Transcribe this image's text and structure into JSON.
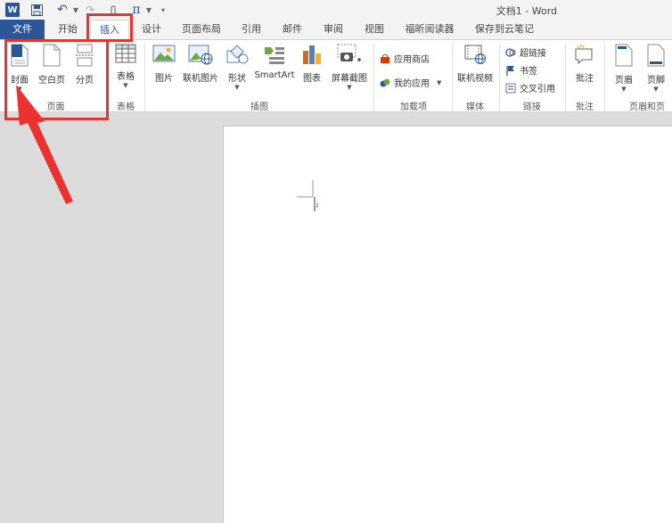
{
  "window": {
    "title": "文档1 - Word"
  },
  "quick_access": {
    "app_icon": "W",
    "items": [
      "word-icon",
      "save-icon",
      "undo-icon",
      "redo-icon",
      "touch-mode-icon",
      "equation-icon",
      "customize-arrow-icon"
    ],
    "pi_symbol": "π"
  },
  "tabs": [
    {
      "label": "文件"
    },
    {
      "label": "开始"
    },
    {
      "label": "插入"
    },
    {
      "label": "设计"
    },
    {
      "label": "页面布局"
    },
    {
      "label": "引用"
    },
    {
      "label": "邮件"
    },
    {
      "label": "审阅"
    },
    {
      "label": "视图"
    },
    {
      "label": "福昕阅读器"
    },
    {
      "label": "保存到云笔记"
    }
  ],
  "active_tab": "插入",
  "ribbon": {
    "pages": {
      "label": "页面",
      "cover": "封面",
      "blank_page": "空白页",
      "page_break": "分页"
    },
    "tables": {
      "label": "表格",
      "table": "表格"
    },
    "illustrations": {
      "label": "插图",
      "picture": "图片",
      "online_picture": "联机图片",
      "shapes": "形状",
      "smartart": "SmartArt",
      "chart": "图表",
      "screenshot": "屏幕截图"
    },
    "addins": {
      "label": "加载项",
      "store": "应用商店",
      "my_apps": "我的应用"
    },
    "media": {
      "label": "媒体",
      "online_video": "联机视频"
    },
    "links": {
      "label": "链接",
      "hyperlink": "超链接",
      "bookmark": "书签",
      "cross_reference": "交叉引用"
    },
    "comments": {
      "label": "批注",
      "comment": "批注"
    },
    "header_footer": {
      "label": "页眉和页",
      "header": "页眉",
      "footer": "页脚"
    }
  },
  "colors": {
    "accent": "#2b579a",
    "highlight": "#ec3131"
  }
}
